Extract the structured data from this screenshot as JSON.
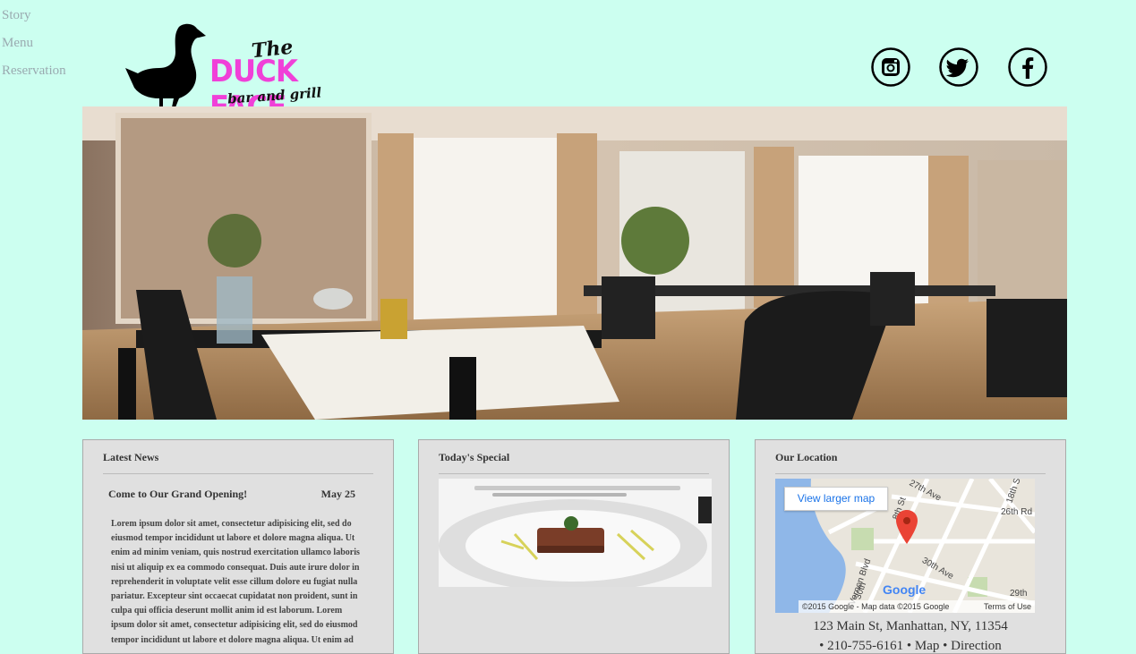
{
  "nav": {
    "items": [
      {
        "label": "Story"
      },
      {
        "label": "Menu"
      },
      {
        "label": "Reservation"
      }
    ]
  },
  "logo": {
    "the": "The",
    "name": "DUCK FACE",
    "tagline": "bar and grill"
  },
  "social": [
    {
      "icon": "instagram-icon"
    },
    {
      "icon": "twitter-icon"
    },
    {
      "icon": "facebook-icon"
    }
  ],
  "colors": {
    "background": "#ccfff0",
    "panel": "#e0e0e0",
    "brand_pink": "#f040d8",
    "nav_text": "#9aaab0"
  },
  "news": {
    "heading": "Latest News",
    "item_title": "Come to Our Grand Opening!",
    "item_date": "May 25",
    "body": "Lorem ipsum dolor sit amet, consectetur adipisicing elit, sed do eiusmod tempor incididunt ut labore et dolore magna aliqua. Ut enim ad minim veniam, quis nostrud exercitation ullamco laboris nisi ut aliquip ex ea commodo consequat. Duis aute irure dolor in reprehenderit in voluptate velit esse cillum dolore eu fugiat nulla pariatur. Excepteur sint occaecat cupidatat non proident, sunt in culpa qui officia deserunt mollit anim id est laborum. Lorem ipsum dolor sit amet, consectetur adipisicing elit, sed do eiusmod tempor incididunt ut labore et dolore magna aliqua. Ut enim ad"
  },
  "special": {
    "heading": "Today's Special"
  },
  "location": {
    "heading": "Our Location",
    "map_button": "View larger map",
    "map_labels": {
      "street1": "27th Ave",
      "street2": "26th Rd",
      "street3": "30th Ave",
      "street4": "8th St",
      "street5": "18th S",
      "street6": "Vernon Blvd",
      "street7": "29th",
      "street8": "30th"
    },
    "google": "Google",
    "copyright": "©2015 Google - Map data ©2015 Google",
    "terms": "Terms of Use",
    "address": "123 Main St, Manhattan, NY, 11354",
    "phone": "• 210-755-6161 • Map • Direction"
  }
}
